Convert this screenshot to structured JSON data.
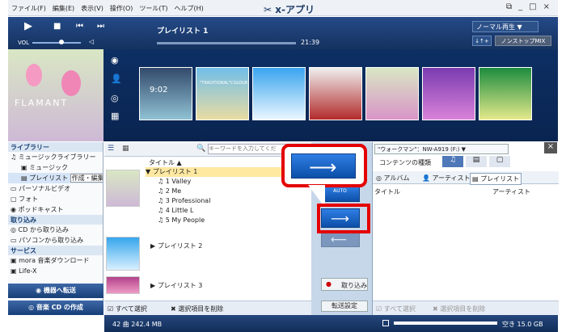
{
  "titlebar": {
    "menu": [
      "ファイル(F)",
      "編集(E)",
      "表示(V)",
      "操作(O)",
      "ツール(T)",
      "ヘルプ(H)"
    ],
    "app_title": "x-アプリ",
    "controls": [
      "⧉",
      "_",
      "□",
      "×"
    ]
  },
  "player": {
    "vol_label": "VOL",
    "playlist_title": "プレイリスト 1",
    "time": "21:39",
    "mode": "ノーマル再生",
    "sort_label": "↓↑+",
    "nonstop": "ノンストップMIX"
  },
  "cover": {
    "left_text": "FLAMANT",
    "time_art": "9:02",
    "album2_text": "\"TRADITIONAL\"COLOUR"
  },
  "sidebar": {
    "library_header": "ライブラリー",
    "items": [
      "ミュージックライブラリー",
      "ミュージック",
      "プレイリスト",
      "パーソナルビデオ",
      "フォト",
      "ポッドキャスト"
    ],
    "create_edit": "作成・編集",
    "import_header": "取り込み",
    "import_items": [
      "CD から取り込み",
      "パソコンから取り込み"
    ],
    "service_header": "サービス",
    "service_items": [
      "mora 音楽ダウンロード",
      "Life-X"
    ],
    "transfer_btn": "機器へ転送",
    "cd_btn": "音楽 CD の作成"
  },
  "middle": {
    "search_placeholder": "キーワードを入力してくだ",
    "col_title": "タイトル",
    "playlists": [
      {
        "name": "プレイリスト 1",
        "tracks": [
          "1 Valley",
          "2 Me",
          "3 Professional",
          "4 Little L",
          "5 My People"
        ]
      },
      {
        "name": "プレイリスト 2"
      },
      {
        "name": "プレイリスト 3"
      }
    ],
    "select_all": "すべて選択",
    "remove_selected": "選択項目を削除"
  },
  "transfer": {
    "auto": "AUTO",
    "import": "取り込み",
    "settings": "転送設定"
  },
  "right": {
    "device": "\"ウォークマン\"：NW-A919 (F:)",
    "content_type": "コンテンツの種類",
    "tabs": [
      "アルバム",
      "アーティスト",
      "プレイリスト"
    ],
    "col_title": "タイトル",
    "col_artist": "アーティスト",
    "select_all": "すべて選択",
    "remove_selected": "選択項目を削除",
    "free": "空き 15.0 GB"
  },
  "status": {
    "count": "42 曲 242.4 MB"
  }
}
